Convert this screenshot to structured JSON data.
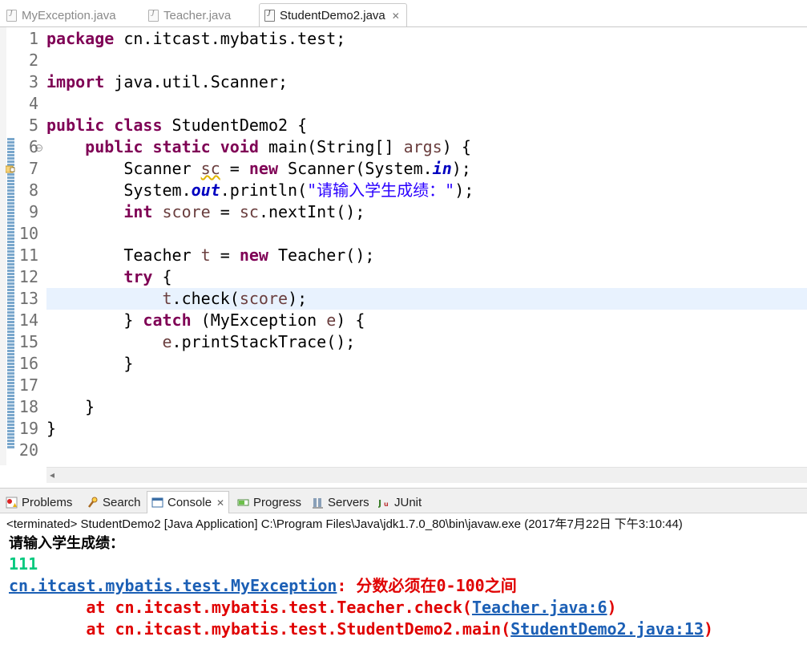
{
  "editor": {
    "tabs": [
      {
        "label": "MyException.java",
        "icon": "java-file-icon",
        "active": false
      },
      {
        "label": "Teacher.java",
        "icon": "java-file-icon",
        "active": false
      },
      {
        "label": "StudentDemo2.java",
        "icon": "java-file-icon",
        "active": true
      }
    ],
    "close_glyph": "✕",
    "line_numbers": [
      "1",
      "2",
      "3",
      "4",
      "5",
      "6",
      "7",
      "8",
      "9",
      "10",
      "11",
      "12",
      "13",
      "14",
      "15",
      "16",
      "17",
      "18",
      "19",
      "20"
    ],
    "fold_glyph": "−",
    "code": {
      "l1": {
        "kw": "package",
        "rest": " cn.itcast.mybatis.test;"
      },
      "l3": {
        "kw": "import",
        "rest": " java.util.Scanner;"
      },
      "l5": {
        "kw1": "public",
        "kw2": "class",
        "rest": " StudentDemo2 {"
      },
      "l6": {
        "indent": "    ",
        "kw1": "public",
        "kw2": "static",
        "kw3": "void",
        "a": " main(String[] ",
        "var": "args",
        "b": ") {"
      },
      "l7": {
        "indent": "        ",
        "a": "Scanner ",
        "var": "sc",
        "b": " = ",
        "kw": "new",
        "c": " Scanner(System.",
        "fld": "in",
        "d": ");"
      },
      "l8": {
        "indent": "        ",
        "a": "System.",
        "fld": "out",
        "b": ".println(",
        "str": "\"请输入学生成绩：\"",
        "c": ");"
      },
      "l9": {
        "indent": "        ",
        "kw": "int",
        "sp": " ",
        "var": "score",
        "b": " = ",
        "var2": "sc",
        "c": ".nextInt();"
      },
      "l11": {
        "indent": "        ",
        "a": "Teacher ",
        "var": "t",
        "b": " = ",
        "kw": "new",
        "c": " Teacher();"
      },
      "l12": {
        "indent": "        ",
        "kw": "try",
        "rest": " {"
      },
      "l13": {
        "indent": "            ",
        "var": "t",
        "a": ".check(",
        "var2": "score",
        "b": ");"
      },
      "l14": {
        "indent": "        ",
        "a": "} ",
        "kw": "catch",
        "b": " (MyException ",
        "var": "e",
        "c": ") {"
      },
      "l15": {
        "indent": "            ",
        "var": "e",
        "a": ".printStackTrace();"
      },
      "l16": {
        "text": "        }"
      },
      "l18": {
        "text": "    }"
      },
      "l19": {
        "text": "}"
      }
    },
    "scroll_left_glyph": "◂"
  },
  "views": {
    "tabs": [
      {
        "label": "Problems",
        "icon": "problems-icon"
      },
      {
        "label": "Search",
        "icon": "search-icon"
      },
      {
        "label": "Console",
        "icon": "console-icon",
        "active": true
      },
      {
        "label": "Progress",
        "icon": "progress-icon"
      },
      {
        "label": "Servers",
        "icon": "servers-icon"
      },
      {
        "label": "JUnit",
        "icon": "junit-icon"
      }
    ],
    "close_glyph": "✕"
  },
  "console": {
    "status": "<terminated> StudentDemo2 [Java Application] C:\\Program Files\\Java\\jdk1.7.0_80\\bin\\javaw.exe (2017年7月22日 下午3:10:44)",
    "prompt": "请输入学生成绩：",
    "input": "111",
    "exception_class": "cn.itcast.mybatis.test.MyException",
    "exception_message": ": 分数必须在0-100之间",
    "trace": [
      {
        "prefix": "        at cn.itcast.mybatis.test.Teacher.check(",
        "link": "Teacher.java:6",
        "suffix": ")"
      },
      {
        "prefix": "        at cn.itcast.mybatis.test.StudentDemo2.main(",
        "link": "StudentDemo2.java:13",
        "suffix": ")"
      }
    ]
  },
  "colors": {
    "keyword": "#7f0055",
    "local_variable": "#6a3e3e",
    "static_field": "#0000c0",
    "string": "#2a00ff",
    "console_input": "#00c87d",
    "console_error": "#e00000",
    "console_link": "#1b5fb5",
    "current_line": "#e8f2fe"
  }
}
